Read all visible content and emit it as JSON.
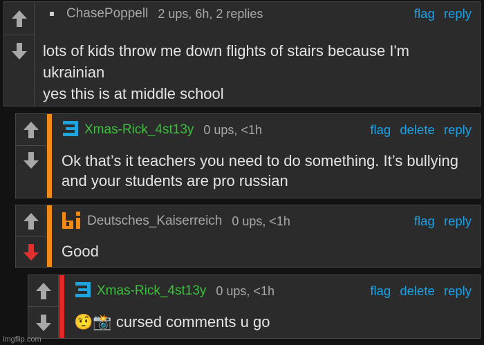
{
  "watermark": "imgflip.com",
  "comments": [
    {
      "user": "ChasePoppell",
      "meta": "2 ups, 6h, 2 replies",
      "actions": [
        "flag",
        "reply"
      ],
      "text": "lots of kids throw me down flights of stairs because I'm ukrainian\nyes this is at middle school",
      "colors": {
        "username": "#a8a8a8"
      }
    },
    {
      "user": "Xmas-Rick_4st13y",
      "meta": "0 ups, <1h",
      "actions": [
        "flag",
        "delete",
        "reply"
      ],
      "text": "Ok that’s it teachers you need to do something. It’s bullying and your students are pro russian",
      "colors": {
        "bar": "#f28b16",
        "badge": "#1fa5de",
        "username": "#3fbf3f"
      }
    },
    {
      "user": "Deutsches_Kaiserreich",
      "meta": "0 ups, <1h",
      "actions": [
        "flag",
        "reply"
      ],
      "text": "Good",
      "downvoted": true,
      "colors": {
        "bar": "#f28b16",
        "badge": "#f28b16",
        "username": "#a8a8a8",
        "downvote": "#e03030"
      }
    },
    {
      "user": "Xmas-Rick_4st13y",
      "meta": "0 ups, <1h",
      "actions": [
        "flag",
        "delete",
        "reply"
      ],
      "text": "🤨📸 cursed comments u go",
      "colors": {
        "bar": "#e02a2a",
        "badge": "#1fa5de",
        "username": "#3fbf3f"
      }
    }
  ]
}
